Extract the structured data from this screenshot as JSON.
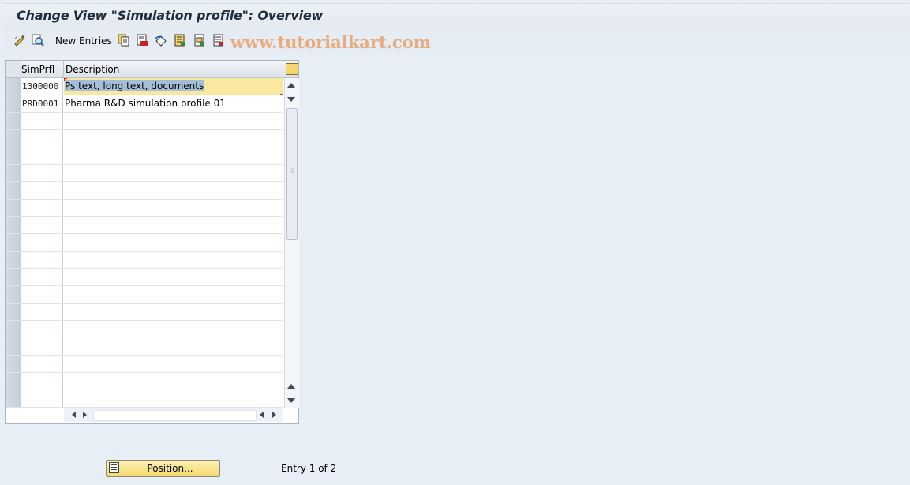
{
  "window": {
    "title": "Change View \"Simulation profile\": Overview"
  },
  "toolbar": {
    "new_entries_label": "New Entries",
    "icons": [
      "display-change-icon",
      "find-icon",
      "copy-as-icon",
      "delete-icon",
      "undo-change-icon",
      "select-all-icon",
      "select-block-icon",
      "deselect-all-icon"
    ],
    "watermark": "www.tutorialkart.com"
  },
  "table": {
    "columns": [
      "SimPrfl",
      "Description"
    ],
    "rows": [
      {
        "simprfl": "1300000",
        "description": "Ps text, long text, documents"
      },
      {
        "simprfl": "PRD0001",
        "description": "Pharma R&D simulation profile 01"
      }
    ]
  },
  "footer": {
    "position_button_label": "Position...",
    "entry_status": "Entry 1 of 2"
  },
  "colors": {
    "background": "#e8eef5",
    "active_row": "#fbe8a0",
    "button": "#f5d96b"
  }
}
